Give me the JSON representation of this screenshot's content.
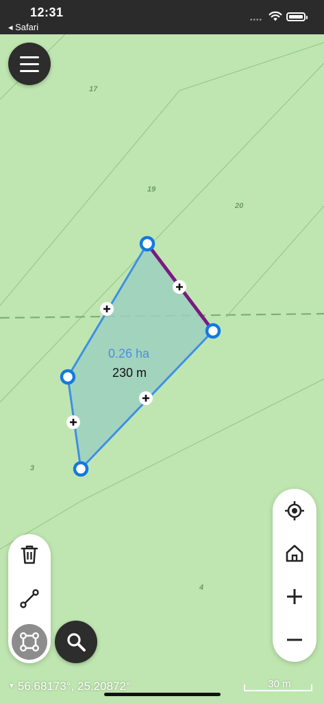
{
  "status_bar": {
    "time": "12:31",
    "back_app": "◂ Safari",
    "signal": "••••"
  },
  "map": {
    "parcel_labels": [
      "17",
      "19",
      "20",
      "3",
      "4"
    ],
    "measurement": {
      "area": "0.26 ha",
      "length": "230 m"
    },
    "colors": {
      "land": "#bfe6b0",
      "polygon_fill": "#9ccfc0",
      "polygon_stroke": "#3d8fe6",
      "selected_edge": "#7a1a7f"
    }
  },
  "controls": {
    "menu_icon": "hamburger-icon",
    "tools": [
      "trash-icon",
      "line-measure-icon",
      "area-measure-icon"
    ],
    "search_icon": "search-icon",
    "nav": [
      "locate-icon",
      "home-icon",
      "zoom-in-icon",
      "zoom-out-icon"
    ]
  },
  "footer": {
    "coordinates": "56.68173°, 25.20872°",
    "scale": "30 m"
  }
}
